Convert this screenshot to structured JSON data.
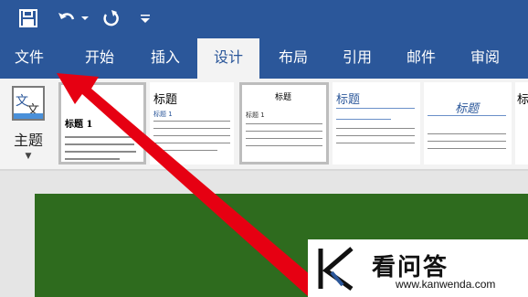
{
  "toolbar": {
    "save_icon": "save-icon",
    "undo_icon": "undo-icon",
    "redo_icon": "redo-icon",
    "customize_icon": "customize-icon"
  },
  "tabs": [
    {
      "label": "文件"
    },
    {
      "label": "开始"
    },
    {
      "label": "插入"
    },
    {
      "label": "设计",
      "active": true
    },
    {
      "label": "布局"
    },
    {
      "label": "引用"
    },
    {
      "label": "邮件"
    },
    {
      "label": "审阅"
    }
  ],
  "theme": {
    "icon_text_1": "文",
    "icon_text_2": "文",
    "label": "主题"
  },
  "styles": [
    {
      "title": "标题 1"
    },
    {
      "title": "标题",
      "heading": "标题 1"
    },
    {
      "title": "标题",
      "heading": "标题 1"
    },
    {
      "title": "标题"
    },
    {
      "title": "标题"
    },
    {
      "title": "标"
    }
  ],
  "watermark": {
    "brand": "看问答",
    "url": "www.kanwenda.com"
  },
  "colors": {
    "brand_blue": "#2b579a",
    "doc_green": "#2e6b1e",
    "arrow_red": "#e60012"
  }
}
